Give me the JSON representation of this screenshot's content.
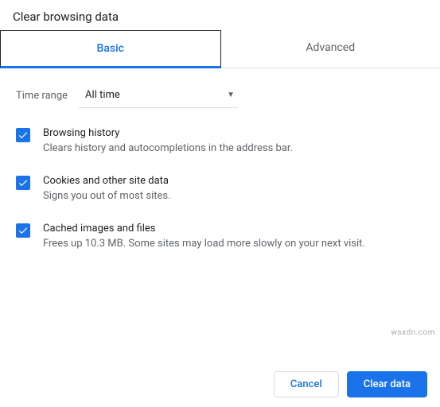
{
  "dialog": {
    "title": "Clear browsing data",
    "tabs": {
      "basic": "Basic",
      "advanced": "Advanced"
    },
    "time_range": {
      "label": "Time range",
      "value": "All time"
    },
    "options": {
      "browsing_history": {
        "title": "Browsing history",
        "desc": "Clears history and autocompletions in the address bar."
      },
      "cookies": {
        "title": "Cookies and other site data",
        "desc": "Signs you out of most sites."
      },
      "cache": {
        "title": "Cached images and files",
        "desc": "Frees up 10.3 MB. Some sites may load more slowly on your next visit."
      }
    },
    "buttons": {
      "cancel": "Cancel",
      "clear": "Clear data"
    }
  },
  "watermark": "wsxdn.com"
}
